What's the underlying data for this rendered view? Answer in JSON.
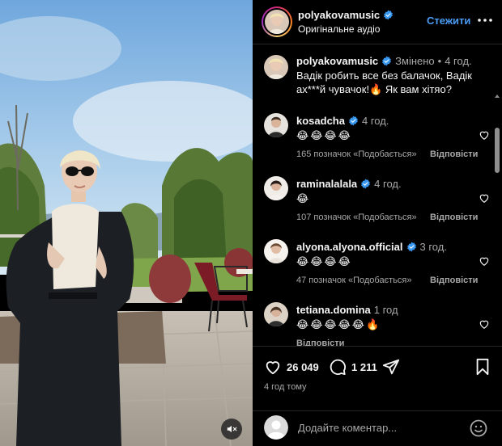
{
  "post": {
    "username": "polyakovamusic",
    "audio": "Оригінальне аудіо",
    "follow_label": "Стежити",
    "more_icon": "more-horizontal-icon",
    "verified_color": "#3897f0"
  },
  "caption": {
    "username": "polyakovamusic",
    "edited": "Змінено",
    "separator": "•",
    "time": "4 год.",
    "text_line1": "Вадік робить все без балачок, Вадік",
    "text_line2": "ах***й чувачок!🔥 Як вам хітяо?"
  },
  "comments": [
    {
      "username": "kosadcha",
      "time": "4 год.",
      "text": "😂😂😂😂",
      "likes": "165 позначок «Подобається»",
      "reply": "Відповісти"
    },
    {
      "username": "raminalalala",
      "time": "4 год.",
      "text": "😂",
      "likes": "107 позначок «Подобається»",
      "reply": "Відповісти"
    },
    {
      "username": "alyona.alyona.official",
      "time": "3 год.",
      "text": "😂😂😂😂",
      "likes": "47 позначок «Подобається»",
      "reply": "Відповісти"
    },
    {
      "username": "tetiana.domina",
      "time": "1 год",
      "text": "😂😂😂😂😂🔥",
      "reply": "Відповісти"
    }
  ],
  "actions": {
    "likes_count": "26 049",
    "comments_count": "1 211",
    "posted": "4 год тому"
  },
  "composer": {
    "placeholder": "Додайте коментар..."
  },
  "colors": {
    "background": "#000000",
    "link": "#4a9df7",
    "muted_text": "#a8a8a8",
    "divider": "#262626"
  }
}
